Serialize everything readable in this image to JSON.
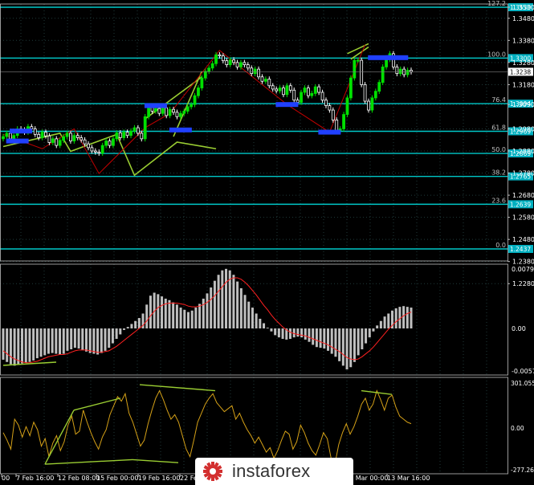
{
  "colors": {
    "background": "#000000",
    "grid": "#1f3a3a",
    "frame": "#c0c0c0",
    "axis_text": "#ffffff",
    "candle_up": "#00e000",
    "candle_down": "#ffffff",
    "fib_line": "#00c8c8",
    "fib_text": "#c0c0c0",
    "fib_box": "#00b0c0",
    "pattern_line": "#9acd32",
    "zigzag": "#c00000",
    "marker": "#2040ff",
    "current_price_box": "#ffffff",
    "macd_hist": "#c0c0c0",
    "macd_signal": "#ff2020",
    "osc_line": "#d4a017",
    "osc_pattern": "#9acd32",
    "logo_red": "#d32f2f"
  },
  "chart_data": [
    {
      "type": "candlestick",
      "pane": "price",
      "y_ticks": [
        "1.3530",
        "1.3480",
        "1.3380",
        "1.3280",
        "1.3180",
        "1.3090",
        "1.2980",
        "1.2880",
        "1.2780",
        "1.2680",
        "1.2580",
        "1.2480",
        "1.2380",
        "1.2280"
      ],
      "fib_levels": [
        {
          "label": "127.2",
          "price": "1.3530"
        },
        {
          "label": "100.0",
          "price": "1.3300"
        },
        {
          "label": "76.4",
          "price": "1.3094"
        },
        {
          "label": "61.8",
          "price": "1.2969"
        },
        {
          "label": "50.0",
          "price": "1.2869"
        },
        {
          "label": "38.2",
          "price": "1.2765"
        },
        {
          "label": "23.6",
          "price": "1.2639"
        },
        {
          "label": "0.0",
          "price": "1.2437"
        }
      ],
      "current_price": "1.3238",
      "close_series": [
        1.2945,
        1.296,
        1.2935,
        1.295,
        1.298,
        1.2975,
        1.2965,
        1.299,
        1.298,
        1.2955,
        1.294,
        1.2965,
        1.2948,
        1.2918,
        1.2935,
        1.2905,
        1.2928,
        1.2945,
        1.296,
        1.2925,
        1.295,
        1.294,
        1.293,
        1.2912,
        1.2895,
        1.288,
        1.2875,
        1.287,
        1.2905,
        1.2925,
        1.2905,
        1.2935,
        1.2962,
        1.294,
        1.2965,
        1.295,
        1.297,
        1.2985,
        1.296,
        1.2935,
        1.3035,
        1.308,
        1.306,
        1.3072,
        1.305,
        1.3075,
        1.304,
        1.3068,
        1.3055,
        1.3035,
        1.305,
        1.306,
        1.308,
        1.309,
        1.313,
        1.3165,
        1.321,
        1.324,
        1.3255,
        1.3275,
        1.3315,
        1.331,
        1.3288,
        1.327,
        1.3292,
        1.328,
        1.326,
        1.328,
        1.327,
        1.3255,
        1.323,
        1.325,
        1.3215,
        1.3195,
        1.3205,
        1.3175,
        1.316,
        1.3152,
        1.3165,
        1.3135,
        1.3175,
        1.3155,
        1.311,
        1.31,
        1.3145,
        1.3165,
        1.313,
        1.314,
        1.317,
        1.3145,
        1.311,
        1.3085,
        1.3065,
        1.302,
        1.2972,
        1.298,
        1.3045,
        1.312,
        1.321,
        1.329,
        1.329,
        1.318,
        1.3105,
        1.3065,
        1.312,
        1.315,
        1.319,
        1.326,
        1.3295,
        1.332,
        1.326,
        1.323,
        1.325,
        1.3225,
        1.3245,
        1.3238
      ],
      "pattern_lines": [
        {
          "points": [
            [
              1.29,
              0
            ],
            [
              1.296,
              16
            ],
            [
              1.2878,
              19
            ],
            [
              1.2955,
              32
            ],
            [
              1.277,
              37
            ],
            [
              1.292,
              49
            ],
            [
              1.289,
              60
            ]
          ],
          "note": "decorative"
        }
      ],
      "blue_markers": [
        [
          1.297,
          5
        ],
        [
          1.2925,
          4
        ],
        [
          1.3085,
          43
        ],
        [
          1.2975,
          50
        ],
        [
          1.309,
          80
        ],
        [
          1.2965,
          92
        ],
        [
          1.3302,
          106
        ],
        [
          1.3302,
          111
        ]
      ]
    },
    {
      "type": "bar",
      "pane": "macd",
      "y_ticks": [
        "0.00798",
        "0.00",
        "-0.00571"
      ],
      "values": [
        -0.0042,
        -0.0045,
        -0.0048,
        -0.005,
        -0.0049,
        -0.0047,
        -0.0046,
        -0.0045,
        -0.0043,
        -0.004,
        -0.0038,
        -0.0036,
        -0.0034,
        -0.0033,
        -0.0034,
        -0.0035,
        -0.0034,
        -0.003,
        -0.0028,
        -0.0026,
        -0.0027,
        -0.0029,
        -0.0031,
        -0.0033,
        -0.0034,
        -0.0035,
        -0.0033,
        -0.003,
        -0.0026,
        -0.002,
        -0.0014,
        -0.0008,
        -0.0002,
        0.0002,
        0.0006,
        0.001,
        0.0014,
        0.002,
        0.0032,
        0.0044,
        0.0048,
        0.0046,
        0.0043,
        0.004,
        0.0038,
        0.0035,
        0.0032,
        0.0028,
        0.0025,
        0.0022,
        0.0024,
        0.0028,
        0.0033,
        0.004,
        0.0047,
        0.0055,
        0.0064,
        0.0072,
        0.0078,
        0.008,
        0.0078,
        0.0072,
        0.0063,
        0.0054,
        0.0045,
        0.0036,
        0.0028,
        0.002,
        0.0013,
        0.0007,
        0.0001,
        -0.0004,
        -0.0009,
        -0.0012,
        -0.0014,
        -0.0015,
        -0.0014,
        -0.0012,
        -0.0011,
        -0.0012,
        -0.0015,
        -0.0018,
        -0.0022,
        -0.0025,
        -0.0026,
        -0.0027,
        -0.003,
        -0.0034,
        -0.0038,
        -0.0044,
        -0.005,
        -0.0055,
        -0.0052,
        -0.0045,
        -0.0036,
        -0.0028,
        -0.002,
        -0.0012,
        -0.0004,
        0.0004,
        0.001,
        0.0016,
        0.002,
        0.0024,
        0.0027,
        0.0029,
        0.003,
        0.0029,
        0.0028
      ],
      "signal": [
        -0.003,
        -0.0034,
        -0.0038,
        -0.0041,
        -0.0043,
        -0.0045,
        -0.0046,
        -0.0046,
        -0.0045,
        -0.0044,
        -0.0042,
        -0.004,
        -0.0038,
        -0.0037,
        -0.0036,
        -0.0035,
        -0.0035,
        -0.0034,
        -0.0032,
        -0.003,
        -0.0029,
        -0.0029,
        -0.0029,
        -0.003,
        -0.0031,
        -0.0032,
        -0.0032,
        -0.0031,
        -0.003,
        -0.0027,
        -0.0024,
        -0.002,
        -0.0016,
        -0.0012,
        -0.0008,
        -0.0004,
        0.0,
        0.0004,
        0.001,
        0.0017,
        0.0023,
        0.0028,
        0.0031,
        0.0033,
        0.0034,
        0.0034,
        0.0034,
        0.0033,
        0.0032,
        0.003,
        0.0029,
        0.0029,
        0.003,
        0.0032,
        0.0035,
        0.0039,
        0.0044,
        0.005,
        0.0056,
        0.0062,
        0.0066,
        0.0068,
        0.0068,
        0.0066,
        0.0062,
        0.0057,
        0.0051,
        0.0045,
        0.0038,
        0.0031,
        0.0025,
        0.0018,
        0.0012,
        0.0007,
        0.0002,
        -0.0002,
        -0.0005,
        -0.0007,
        -0.0008,
        -0.0009,
        -0.001,
        -0.0012,
        -0.0014,
        -0.0016,
        -0.0018,
        -0.002,
        -0.0022,
        -0.0025,
        -0.0028,
        -0.0031,
        -0.0035,
        -0.0039,
        -0.0041,
        -0.0042,
        -0.0041,
        -0.0038,
        -0.0034,
        -0.003,
        -0.0025,
        -0.0019,
        -0.0013,
        -0.0007,
        -0.0001,
        0.0004,
        0.0009,
        0.0013,
        0.0017,
        0.002,
        0.0022
      ]
    },
    {
      "type": "line",
      "pane": "oscillator",
      "y_ticks": [
        "301.0559",
        "0.00",
        "-277.267"
      ],
      "values": [
        -30,
        -80,
        -140,
        60,
        20,
        -60,
        10,
        -50,
        40,
        -10,
        -120,
        -70,
        -190,
        -100,
        -50,
        -150,
        -90,
        20,
        80,
        -40,
        -20,
        120,
        40,
        -30,
        -90,
        -140,
        -60,
        -10,
        90,
        150,
        210,
        180,
        230,
        100,
        40,
        -40,
        -120,
        -80,
        30,
        120,
        200,
        250,
        190,
        120,
        60,
        90,
        40,
        -50,
        -140,
        -190,
        -80,
        40,
        100,
        160,
        200,
        230,
        170,
        140,
        110,
        130,
        150,
        60,
        100,
        40,
        -10,
        -50,
        -100,
        -60,
        -110,
        -160,
        -130,
        -200,
        -150,
        -80,
        -20,
        -40,
        -140,
        -90,
        20,
        -30,
        -100,
        -150,
        -180,
        -110,
        -30,
        -70,
        -200,
        -240,
        -110,
        -30,
        30,
        -40,
        10,
        80,
        160,
        200,
        120,
        160,
        250,
        190,
        120,
        200,
        220,
        140,
        80,
        60,
        40,
        30
      ]
    },
    {
      "type": "axis",
      "pane": "time",
      "tick_labels": [
        "00",
        "7 Feb 16:00",
        "12 Feb 08:00",
        "15 Feb 00:00",
        "19 Feb 16:00",
        "22 Fe",
        "11 Mar 00:00",
        "13 Mar 16:00"
      ]
    }
  ],
  "logo": {
    "icon_name": "instaforex-logo-icon",
    "text": "instaforex"
  }
}
